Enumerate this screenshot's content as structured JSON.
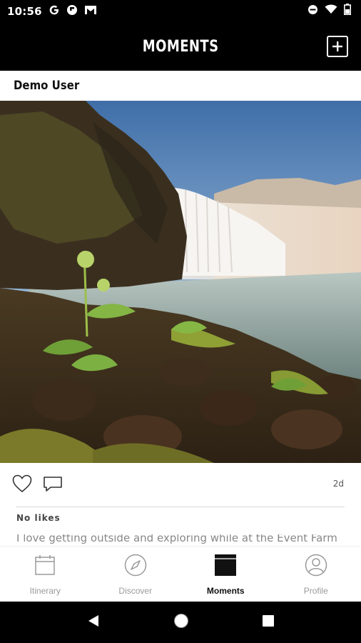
{
  "status_bar": {
    "time": "10:56",
    "left_icons": [
      "google-icon",
      "flipboard-icon",
      "gmail-icon"
    ],
    "right_icons": [
      "do-not-disturb-icon",
      "wifi-icon",
      "battery-icon"
    ]
  },
  "header": {
    "title": "MOMENTS",
    "add_icon": "add-square-icon"
  },
  "post": {
    "user_name": "Demo User",
    "photo_description_icon": "landscape-photo",
    "age": "2d",
    "likes": "No likes",
    "caption": "I love getting outside and exploring while at the Event Farm"
  },
  "tabs": [
    {
      "label": "Itinerary",
      "icon": "calendar-icon",
      "active": false
    },
    {
      "label": "Discover",
      "icon": "compass-icon",
      "active": false
    },
    {
      "label": "Moments",
      "icon": "moments-icon",
      "active": true
    },
    {
      "label": "Profile",
      "icon": "profile-icon",
      "active": false
    }
  ],
  "colors": {
    "header_bg": "#000000",
    "active_tab": "#111111",
    "inactive_tab": "#9a9a9a"
  }
}
